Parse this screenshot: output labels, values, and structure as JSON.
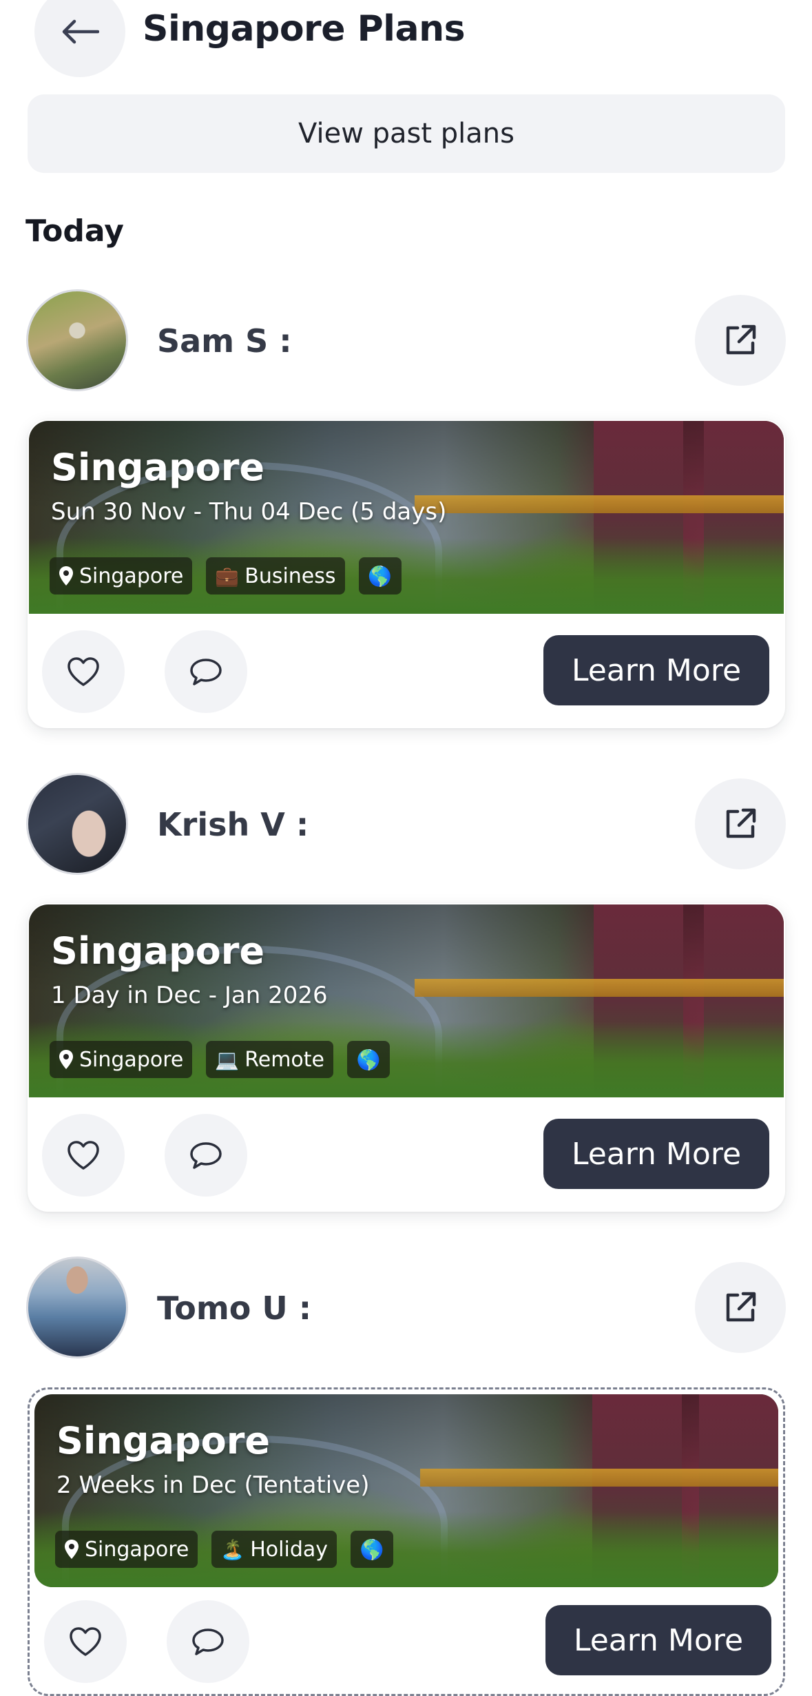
{
  "header": {
    "title": "Singapore Plans"
  },
  "past_plans_label": "View past plans",
  "section_title": "Today",
  "learn_more_label": "Learn More",
  "plans": [
    {
      "user": "Sam S :",
      "avatar_colors": [
        "#6f8c3a",
        "#b9a777",
        "#3e4a3a"
      ],
      "title": "Singapore",
      "dates": "Sun 30 Nov - Thu 04 Dec (5 days)",
      "chips": [
        {
          "icon": "location-pin-icon",
          "label": "Singapore"
        },
        {
          "icon": "briefcase-icon",
          "emoji": "💼",
          "label": "Business"
        },
        {
          "icon": "globe-icon",
          "emoji": "🌎",
          "label": ""
        }
      ]
    },
    {
      "user": "Krish V :",
      "avatar_colors": [
        "#2b3140",
        "#d9c0b3",
        "#1a1d24"
      ],
      "title": "Singapore",
      "dates": "1 Day in Dec - Jan 2026",
      "chips": [
        {
          "icon": "location-pin-icon",
          "label": "Singapore"
        },
        {
          "icon": "laptop-icon",
          "emoji": "💻",
          "label": "Remote"
        },
        {
          "icon": "globe-icon",
          "emoji": "🌎",
          "label": ""
        }
      ]
    },
    {
      "user": "Tomo U :",
      "avatar_colors": [
        "#5a7ea4",
        "#9bb6d1",
        "#2a3750"
      ],
      "title": "Singapore",
      "dates": "2 Weeks in Dec (Tentative)",
      "chips": [
        {
          "icon": "location-pin-icon",
          "label": "Singapore"
        },
        {
          "icon": "island-icon",
          "emoji": "🏝️",
          "label": "Holiday"
        },
        {
          "icon": "globe-icon",
          "emoji": "🌎",
          "label": ""
        }
      ]
    }
  ],
  "colors": {
    "primary_button": "#2f3445",
    "light_button": "#f2f3f6",
    "text_dark": "#1b1f2b"
  }
}
